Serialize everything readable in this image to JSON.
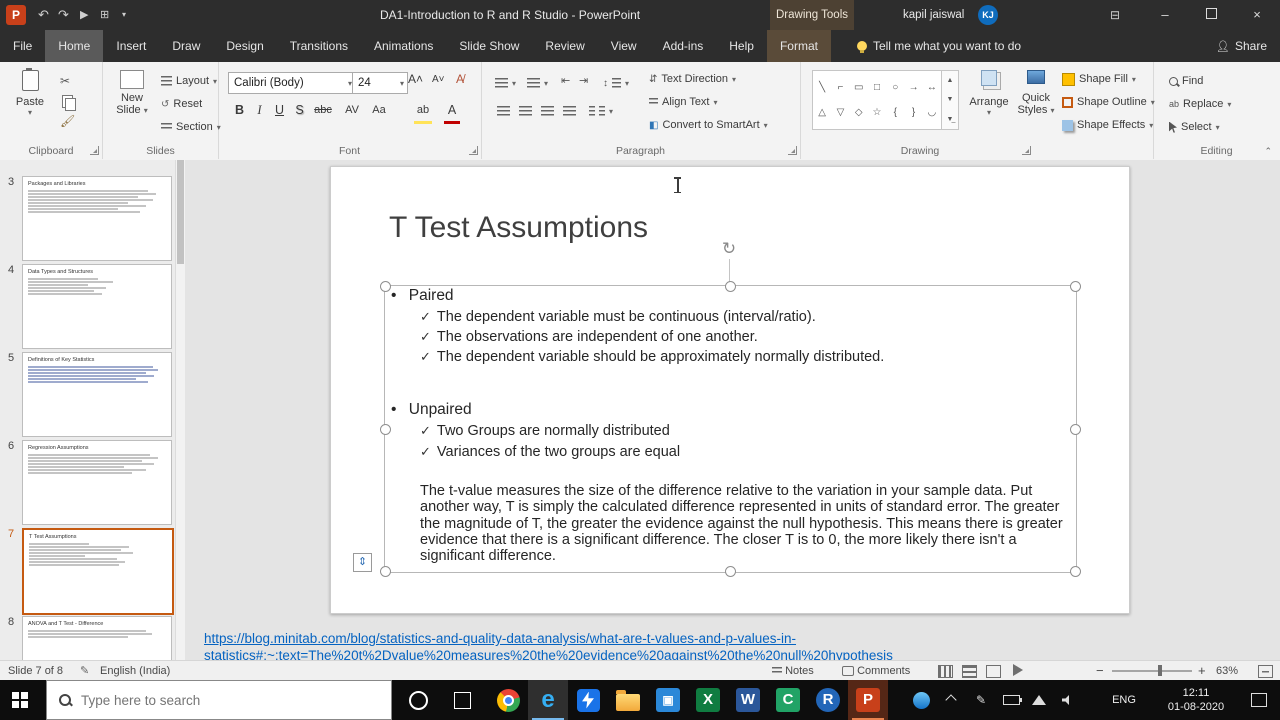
{
  "titlebar": {
    "app_title": "DA1-Introduction to R and R Studio  -  PowerPoint",
    "contextual_group": "Drawing Tools",
    "user_name": "kapil jaiswal",
    "user_initials": "KJ"
  },
  "tabs": {
    "file": "File",
    "home": "Home",
    "insert": "Insert",
    "draw": "Draw",
    "design": "Design",
    "transitions": "Transitions",
    "animations": "Animations",
    "slide_show": "Slide Show",
    "review": "Review",
    "view": "View",
    "add_ins": "Add-ins",
    "help": "Help",
    "format": "Format",
    "tell_me": "Tell me what you want to do",
    "share": "Share"
  },
  "ribbon": {
    "clipboard": {
      "group_label": "Clipboard",
      "paste": "Paste"
    },
    "slides": {
      "group_label": "Slides",
      "new_slide_1": "New",
      "new_slide_2": "Slide",
      "layout": "Layout",
      "reset": "Reset",
      "section": "Section"
    },
    "font": {
      "group_label": "Font",
      "font_name": "Calibri (Body)",
      "font_size": "24",
      "bold": "B",
      "italic": "I",
      "underline": "U",
      "shadow": "S",
      "strikethrough": "abc",
      "char_spacing": "AV",
      "change_case": "Aa",
      "highlight": "ab",
      "font_color": "A"
    },
    "paragraph": {
      "group_label": "Paragraph",
      "text_direction": "Text Direction",
      "align_text": "Align Text",
      "smartart": "Convert to SmartArt"
    },
    "drawing": {
      "group_label": "Drawing",
      "arrange": "Arrange",
      "quick_styles_1": "Quick",
      "quick_styles_2": "Styles",
      "shape_fill": "Shape Fill",
      "shape_outline": "Shape Outline",
      "shape_effects": "Shape Effects"
    },
    "editing": {
      "group_label": "Editing",
      "find": "Find",
      "replace": "Replace",
      "select": "Select"
    }
  },
  "slide_panel": {
    "slides": [
      {
        "number": "3",
        "title": "Packages and Libraries"
      },
      {
        "number": "4",
        "title": "Data Types and Structures"
      },
      {
        "number": "5",
        "title": "Definitions of Key Statistics"
      },
      {
        "number": "6",
        "title": "Regression Assumptions"
      },
      {
        "number": "7",
        "title": "T Test Assumptions"
      },
      {
        "number": "8",
        "title": "ANOVA and T Test - Difference"
      }
    ]
  },
  "slide": {
    "title": "T Test Assumptions",
    "bullet_char": "•",
    "check_char": "✓",
    "paired_heading": "Paired",
    "paired_items": [
      "The dependent variable must be continuous (interval/ratio).",
      "The observations are independent of one another.",
      "The dependent variable should be approximately normally distributed."
    ],
    "unpaired_heading": "Unpaired",
    "unpaired_items": [
      "Two Groups are normally distributed",
      "Variances of the two groups are equal"
    ],
    "body_paragraph": "The t-value measures the size of the difference relative to the variation in your sample data. Put another way, T is simply the calculated difference represented in units of standard error. The greater the magnitude of T, the greater the evidence against the null hypothesis. This means there is greater evidence that there is a significant difference. The closer T is to 0, the more likely there isn't a significant difference."
  },
  "hyperlink": {
    "line1": "https://blog.minitab.com/blog/statistics-and-quality-data-analysis/what-are-t-values-and-p-values-in-",
    "line2": "statistics#:~:text=The%20t%2Dvalue%20measures%20the%20evidence%20against%20the%20null%20hypothesis"
  },
  "status_bar": {
    "slide_indicator": "Slide 7 of 8",
    "language": "English (India)",
    "notes": "Notes",
    "comments": "Comments",
    "zoom_level": "63%"
  },
  "taskbar": {
    "search_placeholder": "Type here to search",
    "language": "ENG",
    "time": "12:11",
    "date": "01-08-2020"
  },
  "colors": {
    "selection_border": "#c55a11",
    "hyperlink_blue": "#0563c1",
    "powerpoint_orange": "#c8401a"
  }
}
